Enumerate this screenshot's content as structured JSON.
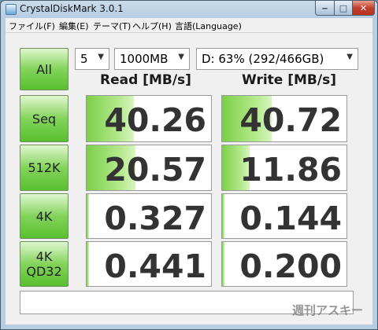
{
  "window": {
    "title": "CrystalDiskMark 3.0.1"
  },
  "menu": [
    "ファイル(F)",
    "編集(E)",
    "テーマ(T)",
    "ヘルプ(H)",
    "言語(Language)"
  ],
  "controls": {
    "all_label": "All",
    "count": "5",
    "size": "1000MB",
    "drive": "D: 63% (292/466GB)"
  },
  "headers": {
    "read": "Read [MB/s]",
    "write": "Write [MB/s]"
  },
  "rows": [
    {
      "label": "Seq",
      "read": "40.26",
      "write": "40.72",
      "read_fill": 0.38,
      "write_fill": 0.4
    },
    {
      "label": "512K",
      "read": "20.57",
      "write": "11.86",
      "read_fill": 0.39,
      "write_fill": 0.22
    },
    {
      "label": "4K",
      "read": "0.327",
      "write": "0.144",
      "read_fill": 0.02,
      "write_fill": 0.02
    },
    {
      "label": "4K\nQD32",
      "read": "0.441",
      "write": "0.200",
      "read_fill": 0.02,
      "write_fill": 0.02
    }
  ],
  "comment": "",
  "watermark": "週刊アスキー",
  "colors": {
    "accent_green": "#58c02f",
    "close_red": "#c2402b"
  }
}
